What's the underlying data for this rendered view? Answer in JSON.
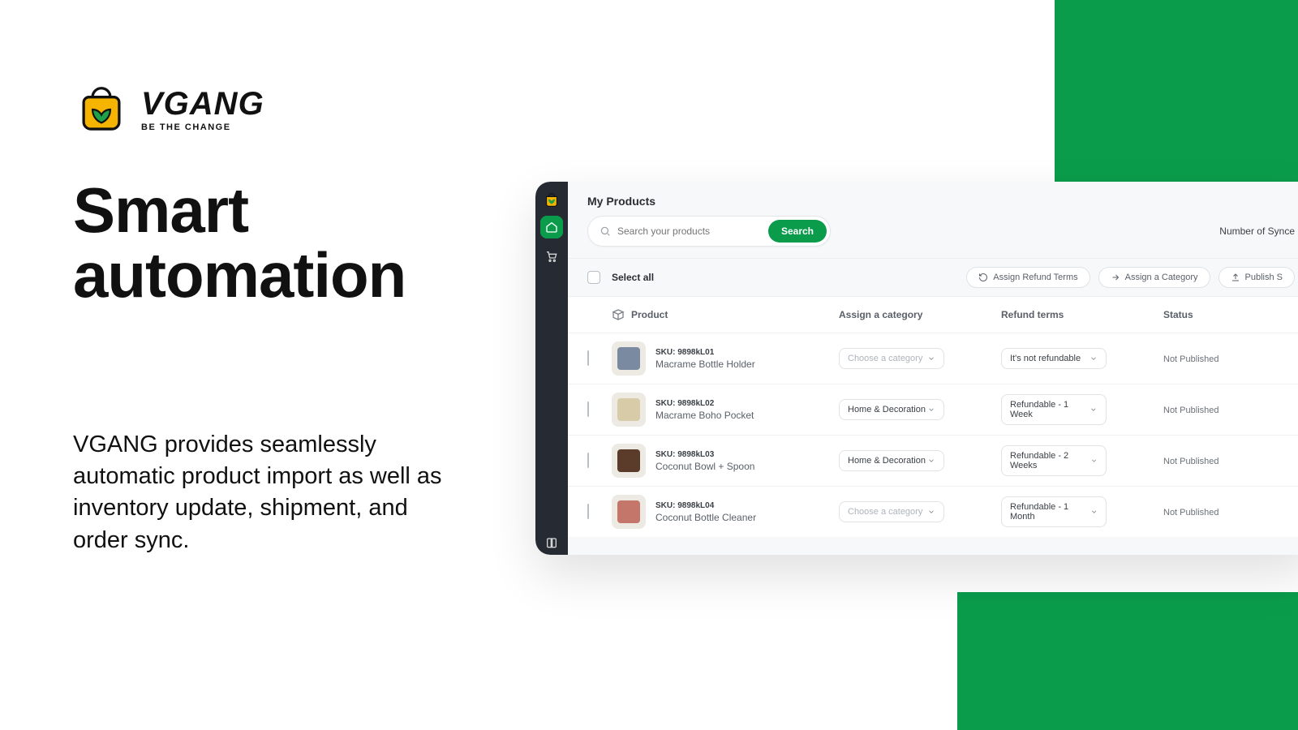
{
  "brand": {
    "name": "VGANG",
    "tagline": "BE THE CHANGE"
  },
  "hero": {
    "title_line1": "Smart",
    "title_line2": "automation",
    "body": "VGANG provides seamlessly automatic product import as well as inventory update, shipment, and order sync."
  },
  "page": {
    "title": "My Products",
    "search_placeholder": "Search your products",
    "search_button": "Search",
    "sync_label": "Number of Synce",
    "select_all": "Select all",
    "btn_refund": "Assign Refund Terms",
    "btn_category": "Assign a Category",
    "btn_publish": "Publish S"
  },
  "columns": {
    "product": "Product",
    "category": "Assign a category",
    "terms": "Refund terms",
    "status": "Status"
  },
  "category_placeholder": "Choose a category",
  "rows": [
    {
      "sku": "SKU: 9898kL01",
      "name": "Macrame Bottle Holder",
      "category": "",
      "terms": "It's not refundable",
      "status": "Not Published",
      "thumb": "#7a8aa0"
    },
    {
      "sku": "SKU: 9898kL02",
      "name": "Macrame Boho Pocket",
      "category": "Home & Decoration",
      "terms": "Refundable - 1 Week",
      "status": "Not Published",
      "thumb": "#d8cba8"
    },
    {
      "sku": "SKU: 9898kL03",
      "name": "Coconut Bowl + Spoon",
      "category": "Home & Decoration",
      "terms": "Refundable - 2 Weeks",
      "status": "Not Published",
      "thumb": "#5b3b2a"
    },
    {
      "sku": "SKU: 9898kL04",
      "name": "Coconut Bottle Cleaner",
      "category": "",
      "terms": "Refundable - 1 Month",
      "status": "Not Published",
      "thumb": "#c4766a"
    }
  ]
}
